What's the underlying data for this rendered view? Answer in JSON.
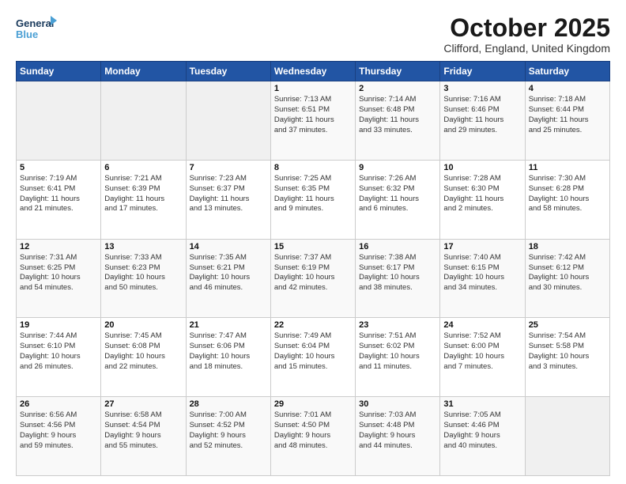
{
  "logo": {
    "line1": "General",
    "line2": "Blue"
  },
  "title": "October 2025",
  "location": "Clifford, England, United Kingdom",
  "days_of_week": [
    "Sunday",
    "Monday",
    "Tuesday",
    "Wednesday",
    "Thursday",
    "Friday",
    "Saturday"
  ],
  "weeks": [
    [
      {
        "day": "",
        "info": ""
      },
      {
        "day": "",
        "info": ""
      },
      {
        "day": "",
        "info": ""
      },
      {
        "day": "1",
        "info": "Sunrise: 7:13 AM\nSunset: 6:51 PM\nDaylight: 11 hours\nand 37 minutes."
      },
      {
        "day": "2",
        "info": "Sunrise: 7:14 AM\nSunset: 6:48 PM\nDaylight: 11 hours\nand 33 minutes."
      },
      {
        "day": "3",
        "info": "Sunrise: 7:16 AM\nSunset: 6:46 PM\nDaylight: 11 hours\nand 29 minutes."
      },
      {
        "day": "4",
        "info": "Sunrise: 7:18 AM\nSunset: 6:44 PM\nDaylight: 11 hours\nand 25 minutes."
      }
    ],
    [
      {
        "day": "5",
        "info": "Sunrise: 7:19 AM\nSunset: 6:41 PM\nDaylight: 11 hours\nand 21 minutes."
      },
      {
        "day": "6",
        "info": "Sunrise: 7:21 AM\nSunset: 6:39 PM\nDaylight: 11 hours\nand 17 minutes."
      },
      {
        "day": "7",
        "info": "Sunrise: 7:23 AM\nSunset: 6:37 PM\nDaylight: 11 hours\nand 13 minutes."
      },
      {
        "day": "8",
        "info": "Sunrise: 7:25 AM\nSunset: 6:35 PM\nDaylight: 11 hours\nand 9 minutes."
      },
      {
        "day": "9",
        "info": "Sunrise: 7:26 AM\nSunset: 6:32 PM\nDaylight: 11 hours\nand 6 minutes."
      },
      {
        "day": "10",
        "info": "Sunrise: 7:28 AM\nSunset: 6:30 PM\nDaylight: 11 hours\nand 2 minutes."
      },
      {
        "day": "11",
        "info": "Sunrise: 7:30 AM\nSunset: 6:28 PM\nDaylight: 10 hours\nand 58 minutes."
      }
    ],
    [
      {
        "day": "12",
        "info": "Sunrise: 7:31 AM\nSunset: 6:25 PM\nDaylight: 10 hours\nand 54 minutes."
      },
      {
        "day": "13",
        "info": "Sunrise: 7:33 AM\nSunset: 6:23 PM\nDaylight: 10 hours\nand 50 minutes."
      },
      {
        "day": "14",
        "info": "Sunrise: 7:35 AM\nSunset: 6:21 PM\nDaylight: 10 hours\nand 46 minutes."
      },
      {
        "day": "15",
        "info": "Sunrise: 7:37 AM\nSunset: 6:19 PM\nDaylight: 10 hours\nand 42 minutes."
      },
      {
        "day": "16",
        "info": "Sunrise: 7:38 AM\nSunset: 6:17 PM\nDaylight: 10 hours\nand 38 minutes."
      },
      {
        "day": "17",
        "info": "Sunrise: 7:40 AM\nSunset: 6:15 PM\nDaylight: 10 hours\nand 34 minutes."
      },
      {
        "day": "18",
        "info": "Sunrise: 7:42 AM\nSunset: 6:12 PM\nDaylight: 10 hours\nand 30 minutes."
      }
    ],
    [
      {
        "day": "19",
        "info": "Sunrise: 7:44 AM\nSunset: 6:10 PM\nDaylight: 10 hours\nand 26 minutes."
      },
      {
        "day": "20",
        "info": "Sunrise: 7:45 AM\nSunset: 6:08 PM\nDaylight: 10 hours\nand 22 minutes."
      },
      {
        "day": "21",
        "info": "Sunrise: 7:47 AM\nSunset: 6:06 PM\nDaylight: 10 hours\nand 18 minutes."
      },
      {
        "day": "22",
        "info": "Sunrise: 7:49 AM\nSunset: 6:04 PM\nDaylight: 10 hours\nand 15 minutes."
      },
      {
        "day": "23",
        "info": "Sunrise: 7:51 AM\nSunset: 6:02 PM\nDaylight: 10 hours\nand 11 minutes."
      },
      {
        "day": "24",
        "info": "Sunrise: 7:52 AM\nSunset: 6:00 PM\nDaylight: 10 hours\nand 7 minutes."
      },
      {
        "day": "25",
        "info": "Sunrise: 7:54 AM\nSunset: 5:58 PM\nDaylight: 10 hours\nand 3 minutes."
      }
    ],
    [
      {
        "day": "26",
        "info": "Sunrise: 6:56 AM\nSunset: 4:56 PM\nDaylight: 9 hours\nand 59 minutes."
      },
      {
        "day": "27",
        "info": "Sunrise: 6:58 AM\nSunset: 4:54 PM\nDaylight: 9 hours\nand 55 minutes."
      },
      {
        "day": "28",
        "info": "Sunrise: 7:00 AM\nSunset: 4:52 PM\nDaylight: 9 hours\nand 52 minutes."
      },
      {
        "day": "29",
        "info": "Sunrise: 7:01 AM\nSunset: 4:50 PM\nDaylight: 9 hours\nand 48 minutes."
      },
      {
        "day": "30",
        "info": "Sunrise: 7:03 AM\nSunset: 4:48 PM\nDaylight: 9 hours\nand 44 minutes."
      },
      {
        "day": "31",
        "info": "Sunrise: 7:05 AM\nSunset: 4:46 PM\nDaylight: 9 hours\nand 40 minutes."
      },
      {
        "day": "",
        "info": ""
      }
    ]
  ]
}
